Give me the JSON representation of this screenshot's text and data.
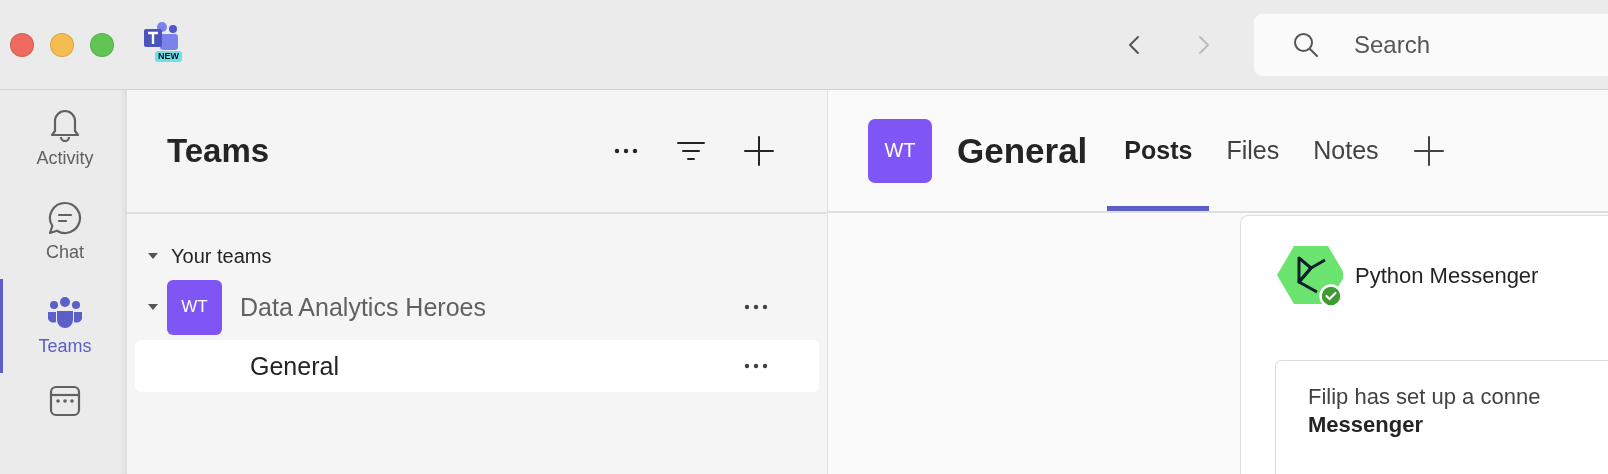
{
  "title_bar": {
    "app_badge": "NEW",
    "nav": [
      {
        "kind": "back",
        "disabled": false
      },
      {
        "kind": "forward",
        "disabled": true
      }
    ],
    "search": {
      "placeholder": "Search"
    }
  },
  "rail": [
    {
      "kind": "bell",
      "label": "Activity",
      "selected": false
    },
    {
      "kind": "chat",
      "label": "Chat",
      "selected": false
    },
    {
      "kind": "teams",
      "label": "Teams",
      "selected": true
    },
    {
      "kind": "calendar",
      "selected": false
    }
  ],
  "teams_panel": {
    "title": "Teams",
    "sections": [
      {
        "label": "Your teams",
        "expanded": true,
        "children": [
          {
            "avatar": "WT",
            "name": "Data Analytics Heroes",
            "expanded": true,
            "children": [
              {
                "name": "General",
                "selected": true
              }
            ]
          }
        ]
      }
    ]
  },
  "channel": {
    "avatar": "WT",
    "title": "General",
    "tabs": [
      {
        "label": "Posts",
        "selected": true
      },
      {
        "label": "Files",
        "selected": false
      },
      {
        "label": "Notes",
        "selected": false
      }
    ]
  },
  "post": {
    "author": "Python Messenger",
    "verified": true,
    "lines": [
      "Filip has set up a conne",
      "**Messenger**"
    ]
  }
}
